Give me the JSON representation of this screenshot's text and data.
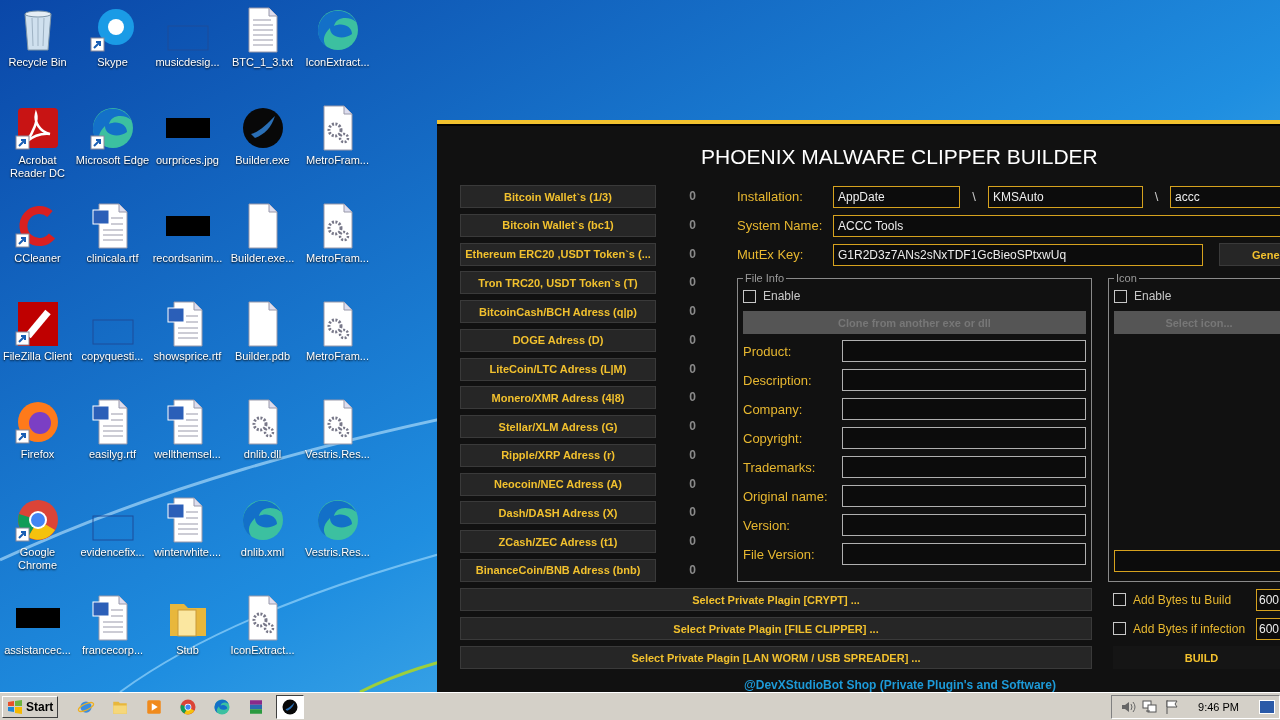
{
  "desktop": {
    "icons": [
      {
        "label": "Recycle Bin",
        "kind": "recycle",
        "shortcut": false
      },
      {
        "label": "Skype",
        "kind": "skype",
        "shortcut": true
      },
      {
        "label": "musicdesig...",
        "kind": "blank",
        "shortcut": false
      },
      {
        "label": "BTC_1_3.txt",
        "kind": "txt",
        "shortcut": false
      },
      {
        "label": "IconExtract...",
        "kind": "edge",
        "shortcut": false
      },
      {
        "label": "Acrobat Reader DC",
        "kind": "acrobat",
        "shortcut": true
      },
      {
        "label": "Microsoft Edge",
        "kind": "edge",
        "shortcut": true
      },
      {
        "label": "ourprices.jpg",
        "kind": "black",
        "shortcut": false
      },
      {
        "label": "Builder.exe",
        "kind": "phoenix",
        "shortcut": false
      },
      {
        "label": "MetroFram...",
        "kind": "gears",
        "shortcut": false
      },
      {
        "label": "CCleaner",
        "kind": "ccleaner",
        "shortcut": true
      },
      {
        "label": "clinicala.rtf",
        "kind": "word",
        "shortcut": false
      },
      {
        "label": "recordsanim...",
        "kind": "black",
        "shortcut": false
      },
      {
        "label": "Builder.exe...",
        "kind": "file",
        "shortcut": false
      },
      {
        "label": "MetroFram...",
        "kind": "gears",
        "shortcut": false
      },
      {
        "label": "FileZilla Client",
        "kind": "filezilla",
        "shortcut": true
      },
      {
        "label": "copyquesti...",
        "kind": "blank",
        "shortcut": false
      },
      {
        "label": "showsprice.rtf",
        "kind": "word",
        "shortcut": false
      },
      {
        "label": "Builder.pdb",
        "kind": "file",
        "shortcut": false
      },
      {
        "label": "MetroFram...",
        "kind": "gears",
        "shortcut": false
      },
      {
        "label": "Firefox",
        "kind": "firefox",
        "shortcut": true
      },
      {
        "label": "easilyg.rtf",
        "kind": "word",
        "shortcut": false
      },
      {
        "label": "wellthemsel...",
        "kind": "word",
        "shortcut": false
      },
      {
        "label": "dnlib.dll",
        "kind": "gears",
        "shortcut": false
      },
      {
        "label": "Vestris.Res...",
        "kind": "gears",
        "shortcut": false
      },
      {
        "label": "Google Chrome",
        "kind": "chrome",
        "shortcut": true
      },
      {
        "label": "evidencefix...",
        "kind": "blank",
        "shortcut": false
      },
      {
        "label": "winterwhite....",
        "kind": "word",
        "shortcut": false
      },
      {
        "label": "dnlib.xml",
        "kind": "edge",
        "shortcut": false
      },
      {
        "label": "Vestris.Res...",
        "kind": "edge",
        "shortcut": false
      },
      {
        "label": "assistancec...",
        "kind": "black",
        "shortcut": false
      },
      {
        "label": "francecorp...",
        "kind": "word",
        "shortcut": false
      },
      {
        "label": "Stub",
        "kind": "folder",
        "shortcut": false
      },
      {
        "label": "IconExtract...",
        "kind": "gears",
        "shortcut": false
      }
    ]
  },
  "builder": {
    "title": "PHOENIX MALWARE CLIPPER BUILDER",
    "wallets": [
      {
        "label": "Bitcoin Wallet`s (1/3)",
        "count": "0"
      },
      {
        "label": "Bitcoin Wallet`s (bc1)",
        "count": "0"
      },
      {
        "label": "Ethereum ERC20 ,USDT Token`s (...",
        "count": "0"
      },
      {
        "label": "Tron TRC20, USDT Token`s (T)",
        "count": "0"
      },
      {
        "label": "BitcoinCash/BCH Adress (q|p)",
        "count": "0"
      },
      {
        "label": "DOGE Adress (D)",
        "count": "0"
      },
      {
        "label": "LiteCoin/LTC Adress (L|M)",
        "count": "0"
      },
      {
        "label": "Monero/XMR Adress (4|8)",
        "count": "0"
      },
      {
        "label": "Stellar/XLM Adress (G)",
        "count": "0"
      },
      {
        "label": "Ripple/XRP Adress (r)",
        "count": "0"
      },
      {
        "label": "Neocoin/NEC Adress (A)",
        "count": "0"
      },
      {
        "label": "Dash/DASH Adress (X)",
        "count": "0"
      },
      {
        "label": "ZCash/ZEC Adress (t1)",
        "count": "0"
      },
      {
        "label": "BinanceCoin/BNB Adress (bnb)",
        "count": "0"
      }
    ],
    "installation": {
      "label": "Installation:",
      "fields": [
        "AppDate",
        "KMSAuto",
        "accc"
      ],
      "separators": [
        "\\",
        "\\"
      ]
    },
    "system_name": {
      "label": "System Name:",
      "value": "ACCC Tools"
    },
    "mutex": {
      "label": "MutEx Key:",
      "value": "G1R2D3z7ANs2sNxTDF1GcBieoSPtxwUq",
      "button": "Gene"
    },
    "file_info": {
      "title": "File Info",
      "enable": {
        "label": "Enable",
        "checked": false
      },
      "clone_button": {
        "label": "Clone from another exe or dll",
        "disabled": true
      },
      "fields": [
        {
          "label": "Product:"
        },
        {
          "label": "Description:"
        },
        {
          "label": "Company:"
        },
        {
          "label": "Copyright:"
        },
        {
          "label": "Trademarks:"
        },
        {
          "label": "Original name:"
        },
        {
          "label": "Version:"
        },
        {
          "label": "File Version:"
        }
      ]
    },
    "icon_group": {
      "title": "Icon",
      "enable": {
        "label": "Enable",
        "checked": false
      },
      "select_button": {
        "label": "Select icon...",
        "disabled": true
      }
    },
    "plugin_buttons": [
      "Select Private Plagin [CRYPT] ...",
      "Select Private Plagin [FILE CLIPPER] ...",
      "Select Private Plagin [LAN WORM / USB SPREADER] ..."
    ],
    "add_bytes": [
      {
        "label": "Add Bytes tu Build",
        "checked": false,
        "value": "600"
      },
      {
        "label": "Add Bytes if infection",
        "checked": false,
        "value": "600"
      }
    ],
    "build_button": "BUILD",
    "footer": "@DevXStudioBot Shop (Private Plugin's and Software)"
  },
  "taskbar": {
    "start": "Start",
    "apps": [
      {
        "kind": "ie",
        "selected": false
      },
      {
        "kind": "explorer",
        "selected": false
      },
      {
        "kind": "media",
        "selected": false
      },
      {
        "kind": "chrome",
        "selected": false
      },
      {
        "kind": "edge",
        "selected": false
      },
      {
        "kind": "winrar",
        "selected": false
      },
      {
        "kind": "phoenix",
        "selected": true
      }
    ],
    "clock": "9:46 PM"
  }
}
